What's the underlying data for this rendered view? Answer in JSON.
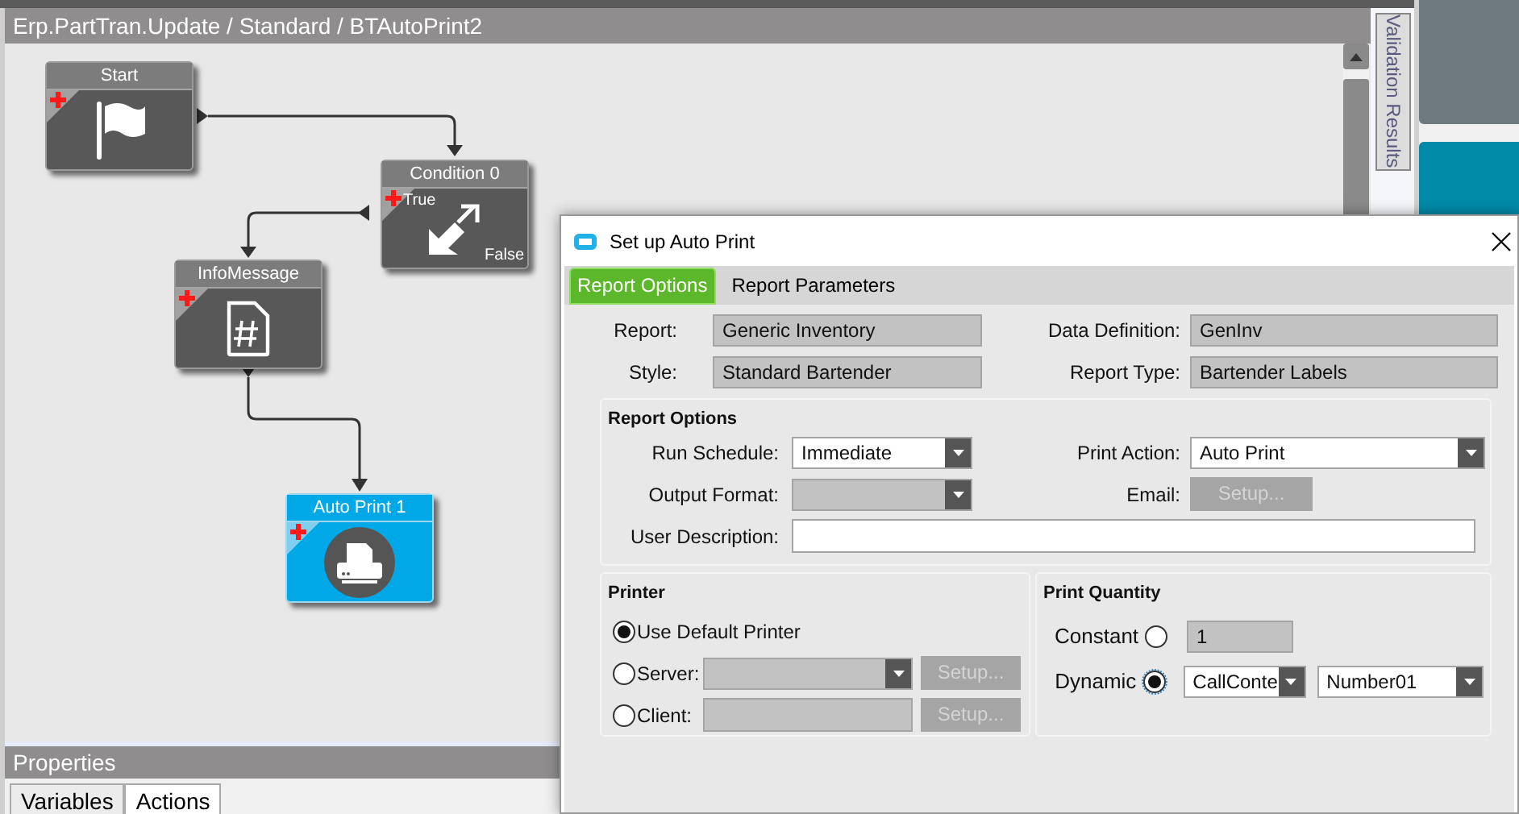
{
  "designer": {
    "title": "Erp.PartTran.Update / Standard / BTAutoPrint2",
    "nodes": [
      {
        "label": "Start",
        "kind": "start",
        "selected": false
      },
      {
        "label": "Condition 0",
        "kind": "condition",
        "selected": false,
        "true_label": "True",
        "false_label": "False"
      },
      {
        "label": "InfoMessage",
        "kind": "message",
        "selected": false
      },
      {
        "label": "Auto Print 1",
        "kind": "print",
        "selected": true
      }
    ],
    "side_tab": "Validation Results"
  },
  "properties": {
    "title": "Properties",
    "tabs": [
      {
        "label": "Variables",
        "selected": false
      },
      {
        "label": "Actions",
        "selected": true
      }
    ]
  },
  "dialog": {
    "title": "Set up Auto Print",
    "tabs": [
      {
        "label": "Report Options",
        "selected": true
      },
      {
        "label": "Report Parameters",
        "selected": false
      }
    ],
    "info_left": [
      {
        "label": "Report:",
        "value": "Generic Inventory"
      },
      {
        "label": "Style:",
        "value": "Standard Bartender"
      }
    ],
    "info_right": [
      {
        "label": "Data Definition:",
        "value": "GenInv"
      },
      {
        "label": "Report Type:",
        "value": "Bartender Labels"
      }
    ],
    "report_options": {
      "title": "Report Options",
      "run_schedule": {
        "label": "Run Schedule:",
        "value": "Immediate"
      },
      "print_action": {
        "label": "Print Action:",
        "value": "Auto Print"
      },
      "output_format": {
        "label": "Output Format:",
        "disabled": true
      },
      "email": {
        "label": "Email:",
        "button": "Setup...",
        "disabled": true
      },
      "user_description": {
        "label": "User Description:"
      }
    },
    "printer": {
      "title": "Printer",
      "options": [
        {
          "label": "Use Default Printer",
          "kind": "plain",
          "selected": true
        },
        {
          "label": "Server:",
          "kind": "dropdown",
          "selected": false,
          "button": "Setup..."
        },
        {
          "label": "Client:",
          "kind": "field",
          "selected": false,
          "button": "Setup..."
        }
      ]
    },
    "print_quantity": {
      "title": "Print Quantity",
      "options": [
        {
          "label": "Constant",
          "kind": "value",
          "selected": false,
          "value": "1"
        },
        {
          "label": "Dynamic",
          "kind": "dropdowns",
          "selected": true,
          "values": [
            "CallConte",
            "Number01"
          ]
        }
      ]
    }
  }
}
